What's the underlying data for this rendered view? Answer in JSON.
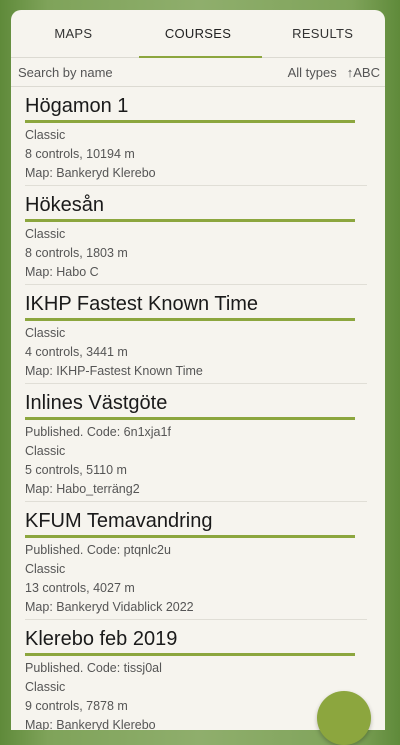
{
  "tabs": [
    {
      "label": "MAPS"
    },
    {
      "label": "COURSES"
    },
    {
      "label": "RESULTS"
    }
  ],
  "filter": {
    "search_placeholder": "Search by name",
    "types": "All types",
    "sort": "↑ABC"
  },
  "courses": [
    {
      "name": "Högamon 1",
      "published": "",
      "type": "Classic",
      "controls": "8 controls, 10194 m",
      "map": "Map: Bankeryd Klerebo"
    },
    {
      "name": "Hökesån",
      "published": "",
      "type": "Classic",
      "controls": "8 controls, 1803 m",
      "map": "Map: Habo C"
    },
    {
      "name": "IKHP Fastest Known Time",
      "published": "",
      "type": "Classic",
      "controls": "4 controls, 3441 m",
      "map": "Map: IKHP-Fastest Known Time"
    },
    {
      "name": "Inlines Västgöte",
      "published": "Published. Code: 6n1xja1f",
      "type": "Classic",
      "controls": "5 controls, 5110 m",
      "map": "Map: Habo_terräng2"
    },
    {
      "name": "KFUM Temavandring",
      "published": "Published. Code: ptqnlc2u",
      "type": "Classic",
      "controls": "13 controls, 4027 m",
      "map": "Map: Bankeryd Vidablick 2022"
    },
    {
      "name": "Klerebo feb 2019",
      "published": "Published. Code: tissj0al",
      "type": "Classic",
      "controls": "9 controls, 7878 m",
      "map": "Map: Bankeryd Klerebo"
    }
  ]
}
